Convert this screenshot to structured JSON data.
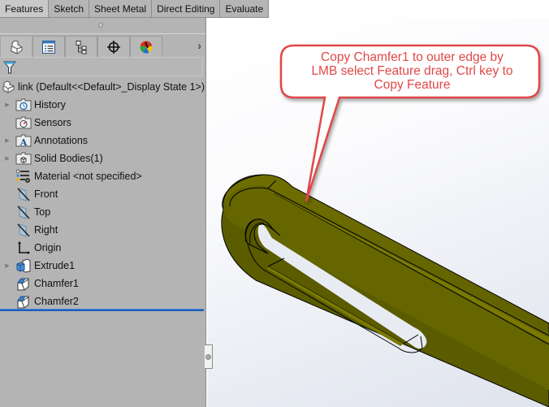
{
  "command_tabs": [
    {
      "label": "Features",
      "active": true
    },
    {
      "label": "Sketch",
      "active": false
    },
    {
      "label": "Sheet Metal",
      "active": false
    },
    {
      "label": "Direct Editing",
      "active": false
    },
    {
      "label": "Evaluate",
      "active": false
    }
  ],
  "panel_tabs": [
    {
      "icon": "feature-manager-icon"
    },
    {
      "icon": "property-manager-icon"
    },
    {
      "icon": "configuration-manager-icon"
    },
    {
      "icon": "dimxpert-manager-icon"
    },
    {
      "icon": "display-manager-icon"
    }
  ],
  "panel_more_label": "›",
  "filter_icon": "filter-icon",
  "tree": {
    "root": {
      "label": "link  (Default<<Default>_Display State 1>)",
      "icon": "part-icon"
    },
    "items": [
      {
        "label": "History",
        "icon": "history-folder-icon",
        "expandable": true
      },
      {
        "label": "Sensors",
        "icon": "sensors-folder-icon",
        "expandable": false
      },
      {
        "label": "Annotations",
        "icon": "annotations-folder-icon",
        "expandable": true
      },
      {
        "label": "Solid Bodies(1)",
        "icon": "solid-bodies-folder-icon",
        "expandable": true
      },
      {
        "label": "Material <not specified>",
        "icon": "material-icon",
        "expandable": false
      },
      {
        "label": "Front",
        "icon": "plane-icon",
        "expandable": false
      },
      {
        "label": "Top",
        "icon": "plane-icon",
        "expandable": false
      },
      {
        "label": "Right",
        "icon": "plane-icon",
        "expandable": false
      },
      {
        "label": "Origin",
        "icon": "origin-icon",
        "expandable": false
      },
      {
        "label": "Extrude1",
        "icon": "extrude-icon",
        "expandable": true
      },
      {
        "label": "Chamfer1",
        "icon": "chamfer-icon",
        "expandable": false
      },
      {
        "label": "Chamfer2",
        "icon": "chamfer-icon",
        "expandable": false
      }
    ]
  },
  "callout": {
    "text": "Copy Chamfer1 to outer edge by LMB select Feature drag, Ctrl key to Copy Feature",
    "lines": [
      "Copy Chamfer1 to outer edge by",
      "LMB select Feature drag, Ctrl key to",
      "Copy Feature"
    ],
    "color": "#e04848"
  },
  "model": {
    "color": "#6b6b00",
    "name": "link"
  }
}
